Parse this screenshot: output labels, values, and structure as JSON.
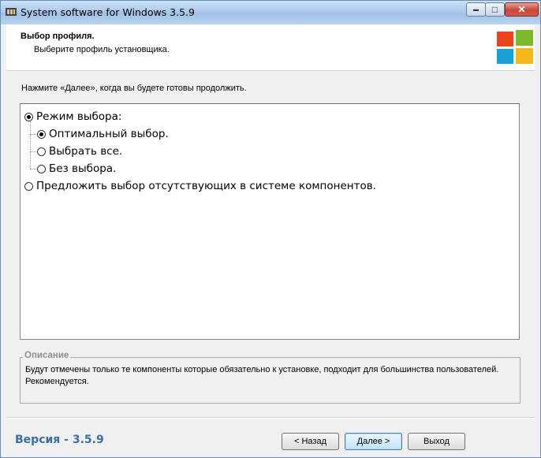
{
  "window": {
    "title": "System software for Windows 3.5.9"
  },
  "caption_buttons": {
    "minimize": "▬",
    "maximize": "□",
    "close": "✕"
  },
  "header": {
    "title": "Выбор профиля.",
    "subtitle": "Выберите профиль установщика."
  },
  "hint": "Нажмите «Далее», когда вы будете готовы продолжить.",
  "tree": {
    "items": [
      {
        "label": "Режим выбора:",
        "selected": true
      },
      {
        "label": "Оптимальный выбор.",
        "selected": true
      },
      {
        "label": "Выбрать все.",
        "selected": false
      },
      {
        "label": "Без выбора.",
        "selected": false
      },
      {
        "label": "Предложить выбор отсутствующих в системе компонентов.",
        "selected": false
      }
    ]
  },
  "description": {
    "legend": "Описание",
    "text": "Будут отмечены только те компоненты которые обязательно к установке, подходит для большинства пользователей. Рекомендуется."
  },
  "footer": {
    "version": "Версия - 3.5.9",
    "back_label": "< Назад",
    "next_label": "Далее >",
    "exit_label": "Выход"
  },
  "colors": {
    "logo_red": "#e8441f",
    "logo_green": "#7cb92c",
    "logo_blue": "#1aa0d8",
    "logo_yellow": "#f6b81a",
    "version_text": "#3c6ea8"
  }
}
